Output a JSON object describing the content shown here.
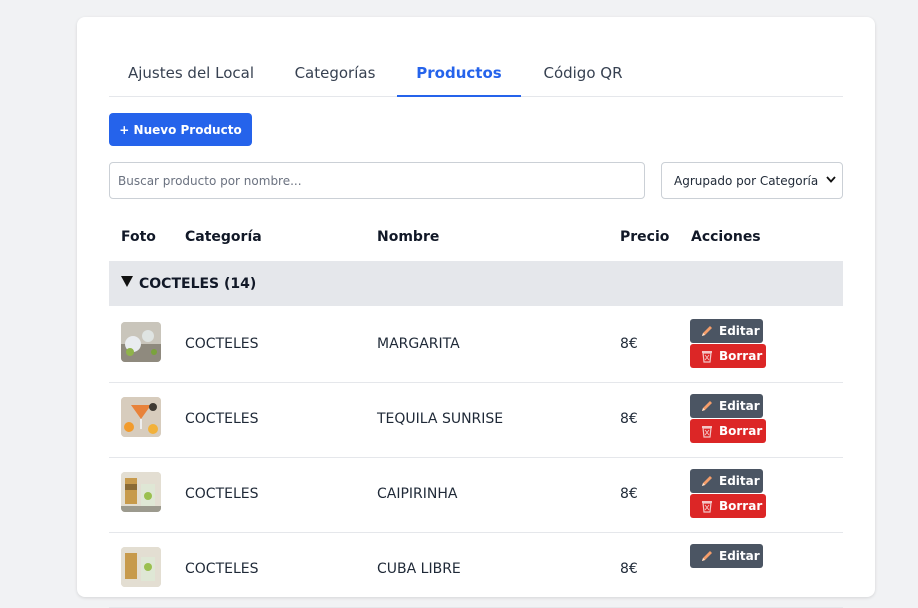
{
  "tabs": [
    {
      "label": "Ajustes del Local"
    },
    {
      "label": "Categorías"
    },
    {
      "label": "Productos"
    },
    {
      "label": "Código QR"
    }
  ],
  "active_tab": "Productos",
  "toolbar": {
    "new_product_label": "+ Nuevo Producto",
    "search_placeholder": "Buscar producto por nombre...",
    "group_select_value": "Agrupado por Categoría"
  },
  "table": {
    "headers": {
      "foto": "Foto",
      "categoria": "Categoría",
      "nombre": "Nombre",
      "precio": "Precio",
      "acciones": "Acciones"
    },
    "group_label": "COCTELES (14)",
    "edit_label": "Editar",
    "delete_label": "Borrar",
    "rows": [
      {
        "categoria": "COCTELES",
        "nombre": "MARGARITA",
        "precio": "8€"
      },
      {
        "categoria": "COCTELES",
        "nombre": "TEQUILA SUNRISE",
        "precio": "8€"
      },
      {
        "categoria": "COCTELES",
        "nombre": "CAIPIRINHA",
        "precio": "8€"
      },
      {
        "categoria": "COCTELES",
        "nombre": "CUBA LIBRE",
        "precio": "8€"
      }
    ]
  },
  "colors": {
    "accent": "#2563eb",
    "edit": "#4b5563",
    "delete": "#dc2626"
  }
}
